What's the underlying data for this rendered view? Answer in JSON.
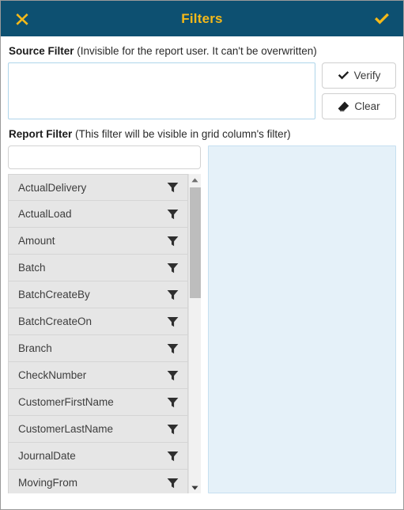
{
  "titlebar": {
    "title": "Filters",
    "close_icon": "close-x-icon",
    "confirm_icon": "check-icon"
  },
  "source_filter": {
    "label": "Source Filter",
    "hint": "(Invisible for the report user. It can't be overwritten)",
    "textarea_value": "",
    "textarea_placeholder": "",
    "buttons": [
      {
        "label": "Verify",
        "icon": "check-icon"
      },
      {
        "label": "Clear",
        "icon": "eraser-icon"
      }
    ]
  },
  "report_filter": {
    "label": "Report Filter",
    "hint": "(This filter will be visible in grid column's filter)",
    "search_value": "",
    "search_placeholder": "",
    "columns": [
      {
        "name": "ActualDelivery",
        "icon": "funnel-icon"
      },
      {
        "name": "ActualLoad",
        "icon": "funnel-icon"
      },
      {
        "name": "Amount",
        "icon": "funnel-icon"
      },
      {
        "name": "Batch",
        "icon": "funnel-icon"
      },
      {
        "name": "BatchCreateBy",
        "icon": "funnel-icon"
      },
      {
        "name": "BatchCreateOn",
        "icon": "funnel-icon"
      },
      {
        "name": "Branch",
        "icon": "funnel-icon"
      },
      {
        "name": "CheckNumber",
        "icon": "funnel-icon"
      },
      {
        "name": "CustomerFirstName",
        "icon": "funnel-icon"
      },
      {
        "name": "CustomerLastName",
        "icon": "funnel-icon"
      },
      {
        "name": "JournalDate",
        "icon": "funnel-icon"
      },
      {
        "name": "MovingFrom",
        "icon": "funnel-icon"
      }
    ],
    "scrollbar": {
      "up_icon": "triangle-up-icon",
      "down_icon": "triangle-down-icon"
    },
    "drop_panel_items": []
  },
  "colors": {
    "header_bg": "#0d5071",
    "header_accent": "#f5b919",
    "list_item_bg": "#e6e6e6",
    "drop_panel_bg": "#e5f1f9",
    "drop_panel_border": "#c6dff0",
    "input_border": "#afd5ea"
  }
}
